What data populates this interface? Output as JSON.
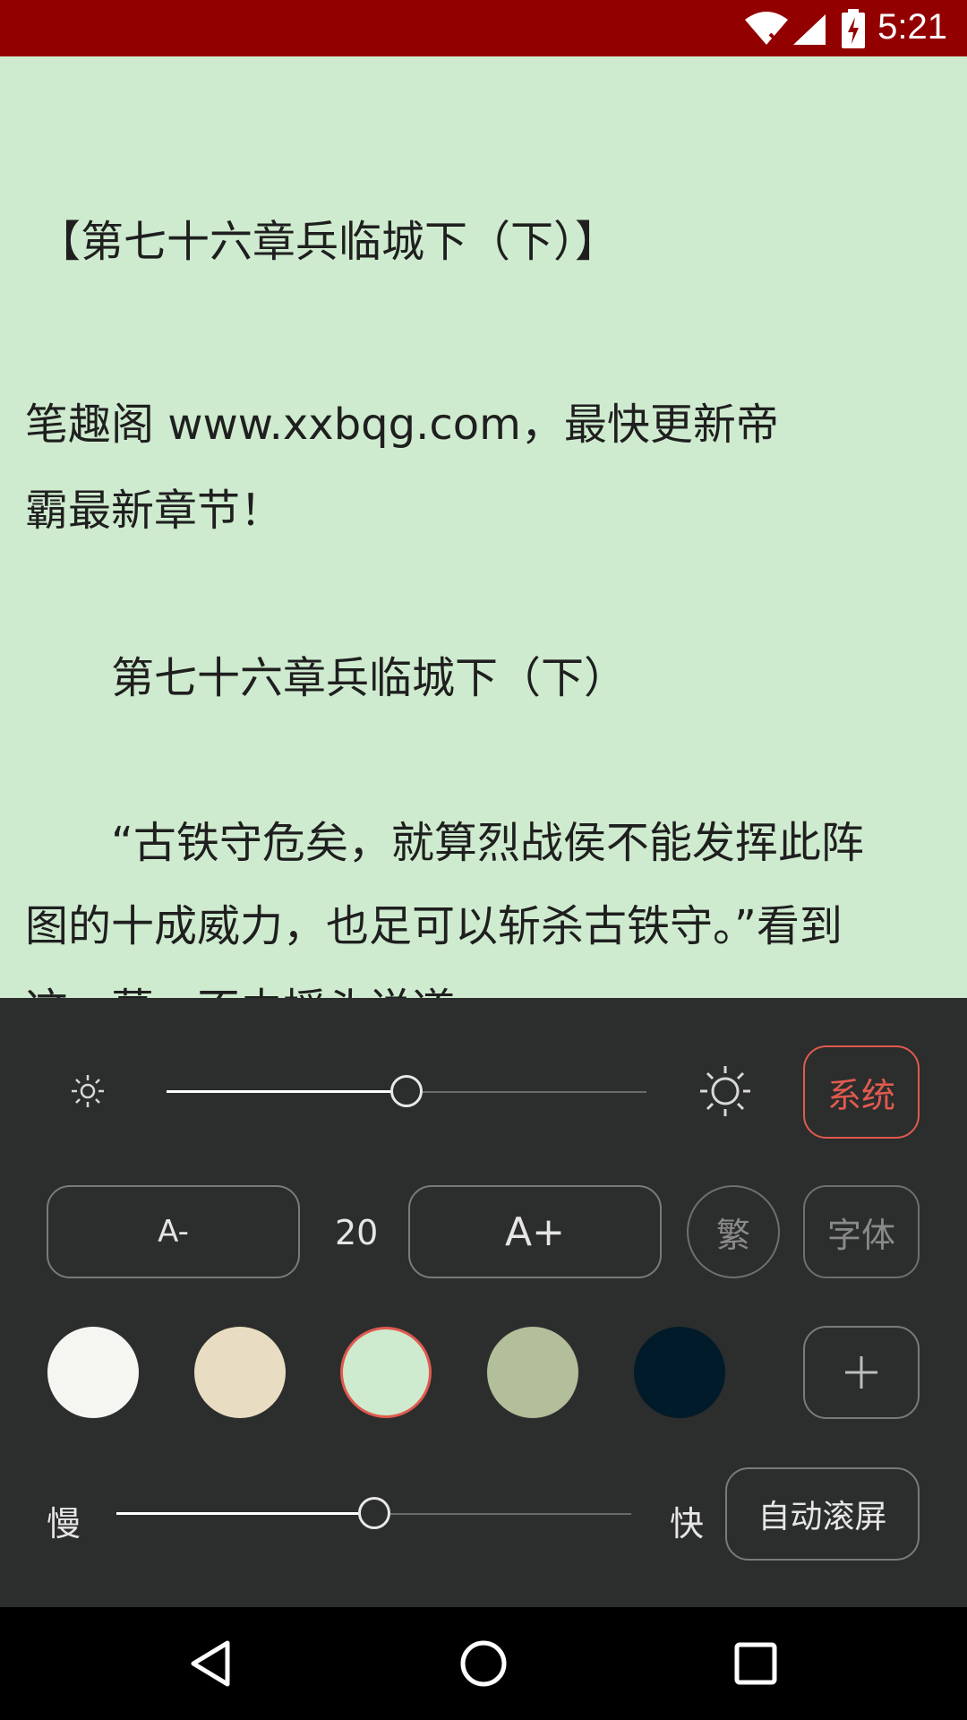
{
  "status_bar": {
    "time": "5:21",
    "background": "#930000",
    "icons": [
      "wifi-icon",
      "signal-icon",
      "battery-charging-icon"
    ]
  },
  "reader": {
    "background": "#cfebcf",
    "lines": [
      "【第七十六章兵临城下（下）】",
      "笔趣阁 www.xxbqg.com，最快更新帝",
      "霸最新章节！",
      "　　第七十六章兵临城下（下）",
      "　　“古铁守危矣，就算烈战侯不能发挥此阵",
      "图的十成威力，也足可以斩杀古铁守。”看到",
      "这一幕，不由摇头说道。"
    ]
  },
  "settings": {
    "brightness": {
      "low_icon": "sun-small-icon",
      "high_icon": "sun-large-icon",
      "level_percent": 50,
      "system_label": "系统"
    },
    "font": {
      "decrease_label": "A-",
      "size_value": "20",
      "increase_label": "A+",
      "traditional_label": "繁",
      "font_label": "字体"
    },
    "themes": {
      "colors": [
        "#f5f5f2",
        "#e8ddc2",
        "#cfebcf",
        "#b3be9a",
        "#011b2a"
      ],
      "selected_index": 2,
      "selected_border": "#e05a4f",
      "add_icon": "plus-icon"
    },
    "autoscroll": {
      "slow_label": "慢",
      "fast_label": "快",
      "speed_percent": 50,
      "auto_scroll_label": "自动滚屏"
    }
  },
  "navbar": {
    "icons": [
      "back-icon",
      "home-icon",
      "recents-icon"
    ]
  }
}
